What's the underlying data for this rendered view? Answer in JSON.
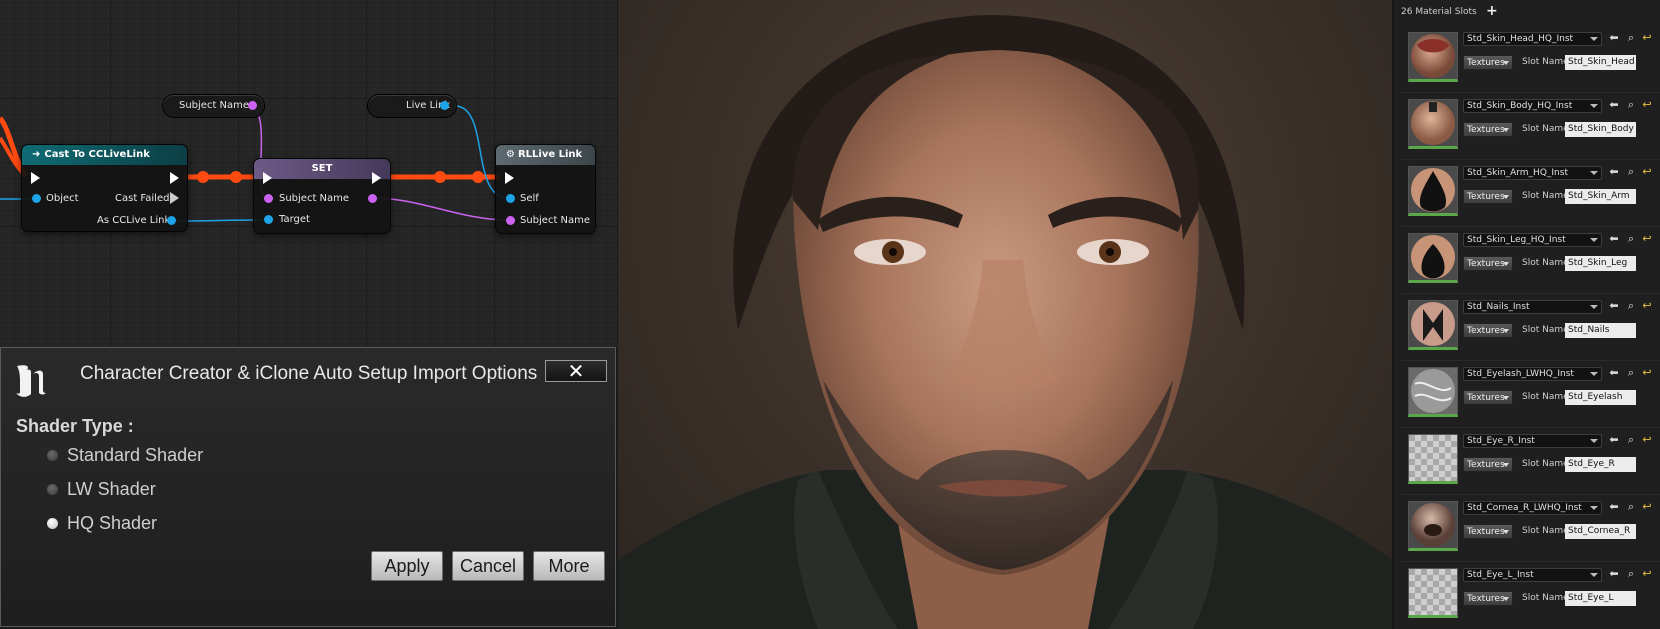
{
  "blueprint": {
    "nodes": {
      "cast": {
        "title": "Cast To CCLiveLink",
        "pins": {
          "object": "Object",
          "cast_failed": "Cast Failed",
          "as_link": "As CCLive Link"
        }
      },
      "set": {
        "title": "SET",
        "pins": {
          "subject_name": "Subject Name",
          "target": "Target"
        }
      },
      "live": {
        "title": "RLLive Link",
        "pins": {
          "self": "Self",
          "subject_name": "Subject Name"
        }
      }
    },
    "variables": {
      "subject_name": "Subject Name",
      "live_link": "Live Link"
    },
    "colors": {
      "exec_wire": "#ff4a12",
      "object_pin": "#1da3e6",
      "string_pin": "#cc63f0",
      "cast_header": "#0f6b74",
      "set_header": "#6d5a86",
      "func_header": "#5e6b72"
    }
  },
  "dialog": {
    "title": "Character Creator & iClone Auto Setup Import Options",
    "close_label": "✕",
    "section_label": "Shader Type :",
    "options": [
      {
        "label": "Standard Shader",
        "selected": false
      },
      {
        "label": "LW Shader",
        "selected": false
      },
      {
        "label": "HQ Shader",
        "selected": true
      }
    ],
    "buttons": {
      "apply": "Apply",
      "cancel": "Cancel",
      "more": "More"
    }
  },
  "material_panel": {
    "header": "26 Material Slots",
    "add_icon": "+",
    "slot_name_label": "Slot Name",
    "textures_label": "Textures",
    "slots": [
      {
        "material": "Std_Skin_Head_HQ_Inst",
        "slot_name": "Std_Skin_Head",
        "thumb": "skin-head"
      },
      {
        "material": "Std_Skin_Body_HQ_Inst",
        "slot_name": "Std_Skin_Body",
        "thumb": "skin-body"
      },
      {
        "material": "Std_Skin_Arm_HQ_Inst",
        "slot_name": "Std_Skin_Arm",
        "thumb": "skin-arm"
      },
      {
        "material": "Std_Skin_Leg_HQ_Inst",
        "slot_name": "Std_Skin_Leg",
        "thumb": "skin-leg"
      },
      {
        "material": "Std_Nails_Inst",
        "slot_name": "Std_Nails",
        "thumb": "nails"
      },
      {
        "material": "Std_Eyelash_LWHQ_Inst",
        "slot_name": "Std_Eyelash",
        "thumb": "eyelash"
      },
      {
        "material": "Std_Eye_R_Inst",
        "slot_name": "Std_Eye_R",
        "thumb": "checker"
      },
      {
        "material": "Std_Cornea_R_LWHQ_Inst",
        "slot_name": "Std_Cornea_R",
        "thumb": "cornea"
      },
      {
        "material": "Std_Eye_L_Inst",
        "slot_name": "Std_Eye_L",
        "thumb": "checker"
      }
    ]
  }
}
